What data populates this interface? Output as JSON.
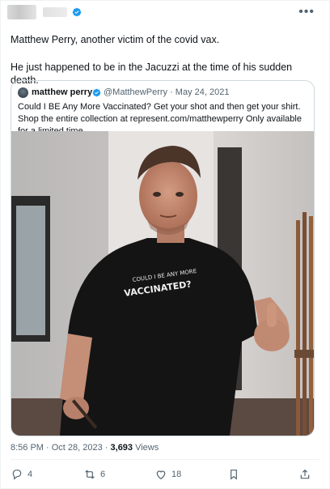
{
  "tweet": {
    "line1": "Matthew Perry, another victim of the covid vax.",
    "line2": "He just happened to be in the Jacuzzi at the time of his sudden death.",
    "more_icon": "more-horizontal-icon",
    "verified_icon": "verified-badge-icon"
  },
  "quote": {
    "name": "matthew perry",
    "handle": "@MatthewPerry · May 24, 2021",
    "text": "Could I BE Any More Vaccinated? Get your shot and then get your shirt. Shop the entire collection at represent.com/matthewperry Only available for a limited time",
    "shirt_text": "COULD I BE ANY MORE VACCINATED?"
  },
  "meta": {
    "time": "8:56 PM · Oct 28, 2023 · ",
    "views_count": "3,693",
    "views_label": " Views"
  },
  "actions": {
    "replies": "4",
    "reposts": "6",
    "likes": "18"
  },
  "colors": {
    "accent": "#1d9bf0",
    "muted": "#536471",
    "border": "#cfd9de"
  }
}
